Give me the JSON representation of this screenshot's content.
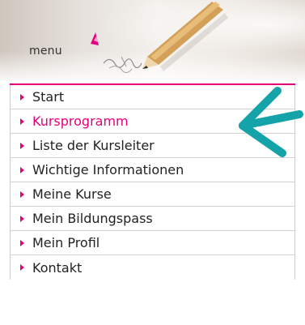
{
  "header": {
    "title": "menu"
  },
  "menu": {
    "items": [
      {
        "label": "Start",
        "active": false
      },
      {
        "label": "Kursprogramm",
        "active": true
      },
      {
        "label": "Liste der Kursleiter",
        "active": false
      },
      {
        "label": "Wichtige Informationen",
        "active": false
      },
      {
        "label": "Meine Kurse",
        "active": false
      },
      {
        "label": "Mein Bildungspass",
        "active": false
      },
      {
        "label": "Mein Profil",
        "active": false
      },
      {
        "label": "Kontakt",
        "active": false
      }
    ]
  },
  "colors": {
    "accent": "#e6007e",
    "annotation": "#13a3a8",
    "text": "#222222"
  },
  "icons": {
    "bullet": "triangle-right-icon",
    "annotation": "arrow-left-icon"
  }
}
